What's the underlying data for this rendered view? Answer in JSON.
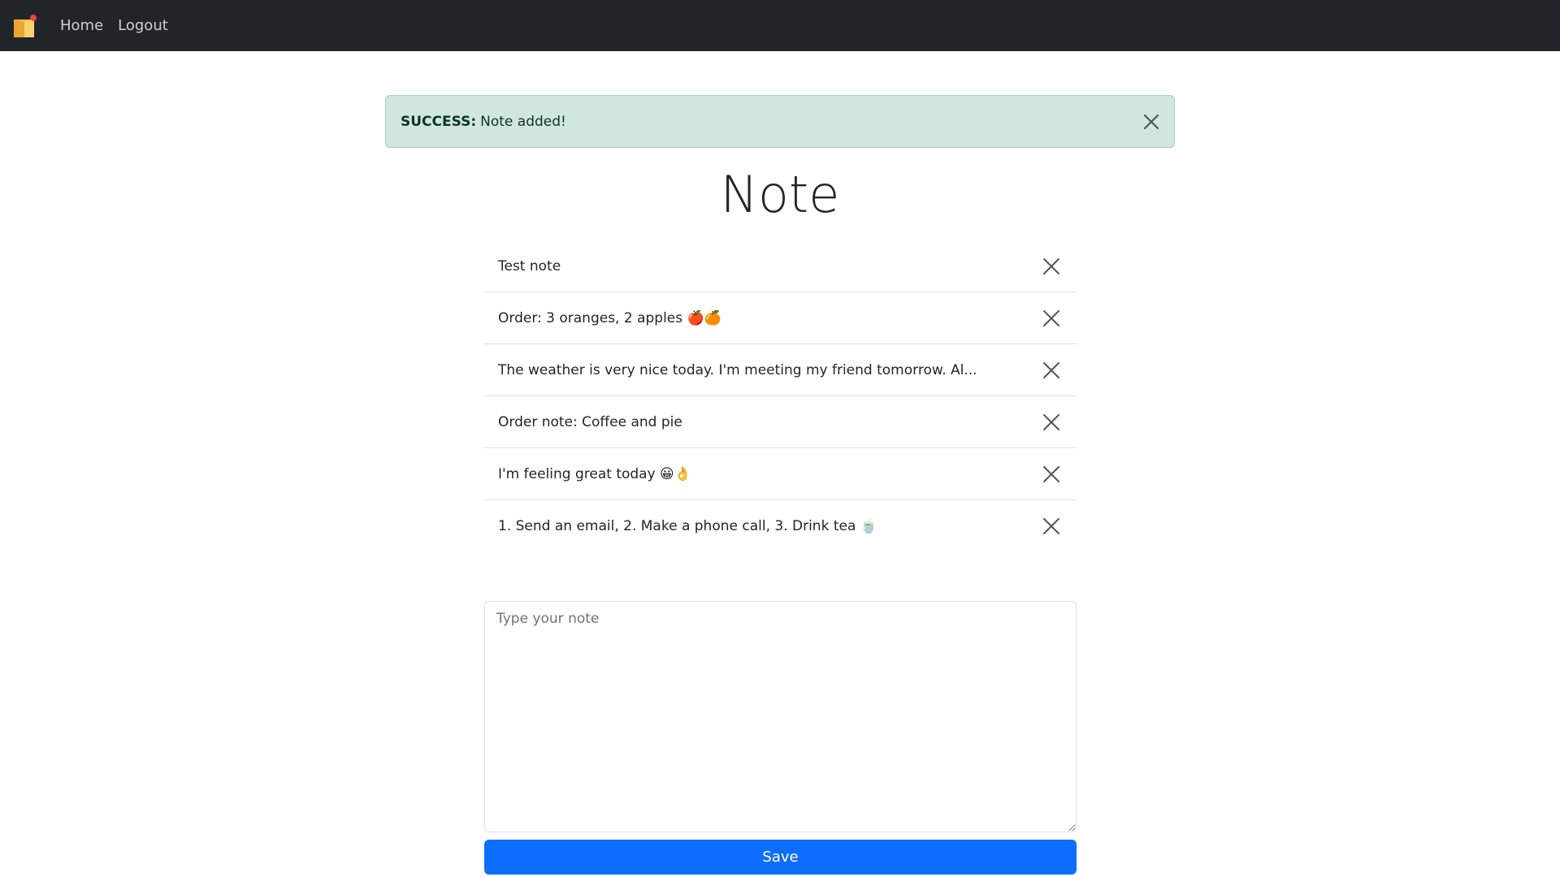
{
  "navbar": {
    "brand_icon": "sticky-note-icon",
    "links": {
      "home": "Home",
      "logout": "Logout"
    }
  },
  "alert": {
    "label": "SUCCESS:",
    "message": "Note added!",
    "close_icon": "close-icon"
  },
  "page": {
    "title": "Note"
  },
  "notes": [
    {
      "text": "Test note"
    },
    {
      "text": "Order: 3 oranges, 2 apples 🍎🍊"
    },
    {
      "text": "The weather is very nice today. I'm meeting my friend tomorrow. Al..."
    },
    {
      "text": "Order note: Coffee and pie"
    },
    {
      "text": "I'm feeling great today 😀👌"
    },
    {
      "text": "1. Send an email, 2. Make a phone call, 3. Drink tea 🍵"
    }
  ],
  "form": {
    "placeholder": "Type your note",
    "value": "",
    "save_label": "Save"
  },
  "colors": {
    "navbar": "#212529",
    "alert_bg": "#d1e7dd",
    "alert_text": "#0a3622",
    "primary": "#0d6efd"
  }
}
